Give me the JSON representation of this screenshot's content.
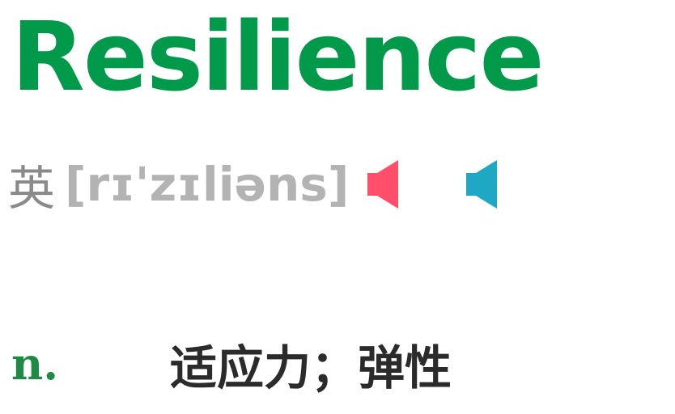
{
  "entry": {
    "word": "Resilience",
    "pronunciation": {
      "lang_label": "英",
      "phonetic": "[rɪ'zɪliəns]"
    },
    "audio_buttons": [
      {
        "icon": "speaker-icon",
        "color": "#ff4f6b"
      },
      {
        "icon": "speaker-icon",
        "color": "#1fa8c4"
      }
    ],
    "definitions": [
      {
        "pos": "n.",
        "meaning": "适应力；弹性"
      }
    ]
  },
  "colors": {
    "headword": "#009a4a",
    "pos": "#1e8a46",
    "phonetic": "#b3b3b3",
    "meaning": "#2b2b2b"
  }
}
